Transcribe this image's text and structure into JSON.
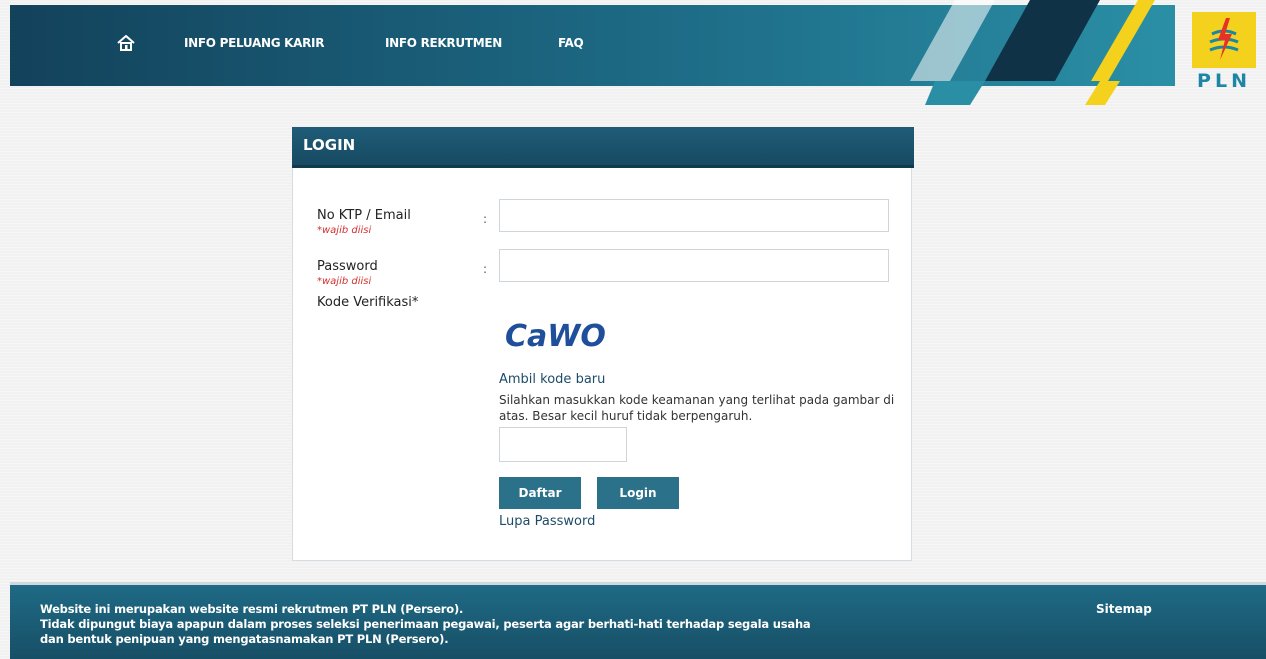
{
  "nav": {
    "home_icon": "home-icon",
    "items": [
      {
        "label": "INFO PELUANG KARIR"
      },
      {
        "label": "INFO REKRUTMEN"
      },
      {
        "label": "FAQ"
      }
    ]
  },
  "brand": {
    "logo_text": "PLN",
    "colors": {
      "primary": "#1d6a85",
      "accent_yellow": "#f4d11d",
      "logo_blue": "#1d86a6",
      "logo_red": "#e63127"
    }
  },
  "login": {
    "title": "LOGIN",
    "fields": [
      {
        "label": "No KTP / Email",
        "required_note": "*wajib diisi",
        "value": ""
      },
      {
        "label": "Password",
        "required_note": "*wajib diisi",
        "value": ""
      }
    ],
    "colon": ":",
    "verification_label": "Kode Verifikasi*",
    "captcha_text": "CaWO",
    "refresh_link": "Ambil kode baru",
    "help_text": "Silahkan masukkan kode keamanan yang terlihat pada gambar di atas. Besar kecil huruf tidak berpengaruh.",
    "captcha_input_value": "",
    "register_button": "Daftar",
    "login_button": "Login",
    "forgot_link": "Lupa Password"
  },
  "footer": {
    "lines": [
      "Website ini merupakan website resmi rekrutmen PT PLN (Persero).",
      "Tidak dipungut biaya apapun dalam proses seleksi penerimaan pegawai, peserta agar berhati-hati terhadap segala usaha",
      "dan bentuk penipuan yang mengatasnamakan PT PLN (Persero)."
    ],
    "sitemap": "Sitemap"
  }
}
